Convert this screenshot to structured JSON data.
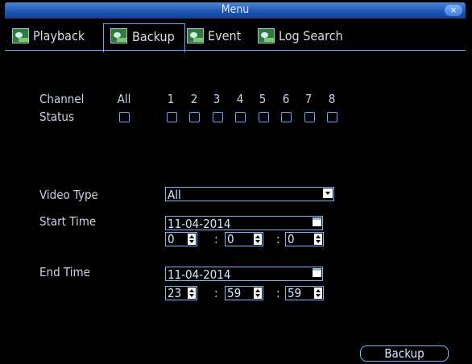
{
  "window": {
    "title": "Menu",
    "close_label": "×"
  },
  "tabs": [
    {
      "label": "Playback"
    },
    {
      "label": "Backup"
    },
    {
      "label": "Event"
    },
    {
      "label": "Log Search"
    }
  ],
  "channel": {
    "label": "Channel",
    "all_label": "All",
    "numbers": [
      "1",
      "2",
      "3",
      "4",
      "5",
      "6",
      "7",
      "8"
    ]
  },
  "status": {
    "label": "Status"
  },
  "video_type": {
    "label": "Video Type",
    "value": "All"
  },
  "start_time": {
    "label": "Start Time",
    "date": "11-04-2014",
    "hour": "0",
    "minute": "0",
    "second": "0"
  },
  "end_time": {
    "label": "End Time",
    "date": "11-04-2014",
    "hour": "23",
    "minute": "59",
    "second": "59"
  },
  "time_separator": ":",
  "backup_button": {
    "label": "Backup"
  }
}
